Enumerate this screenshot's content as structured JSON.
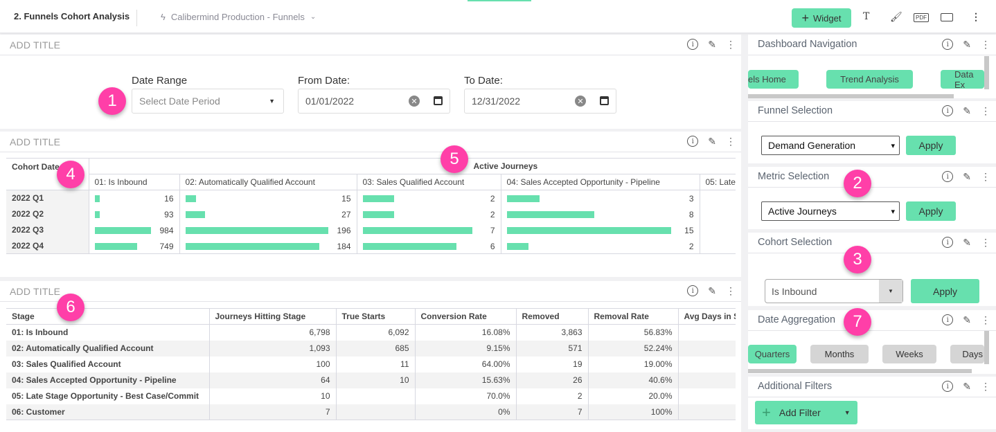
{
  "header": {
    "title": "2. Funnels Cohort Analysis",
    "datasource": "Calibermind Production - Funnels",
    "widget_label": "Widget",
    "icons": [
      "text-icon",
      "brush-icon",
      "pdf-icon",
      "monitor-icon",
      "more-icon"
    ],
    "pdf": "PDF"
  },
  "filters_widget": {
    "title": "ADD TITLE",
    "date_range_label": "Date Range",
    "date_range_placeholder": "Select Date Period",
    "from_label": "From Date:",
    "from_value": "01/01/2022",
    "to_label": "To Date:",
    "to_value": "12/31/2022"
  },
  "pivot_widget": {
    "title": "ADD TITLE",
    "row_header": "Cohort Date",
    "group_header": "Active Journeys",
    "columns": [
      "01: Is Inbound",
      "02: Automatically Qualified Account",
      "03: Sales Qualified Account",
      "04: Sales Accepted Opportunity - Pipeline",
      "05: Late"
    ],
    "rows": [
      {
        "label": "2022 Q1",
        "values": [
          16,
          15,
          2,
          3
        ]
      },
      {
        "label": "2022 Q2",
        "values": [
          93,
          27,
          2,
          8
        ]
      },
      {
        "label": "2022 Q3",
        "values": [
          984,
          196,
          7,
          15
        ]
      },
      {
        "label": "2022 Q4",
        "values": [
          749,
          184,
          6,
          2
        ]
      }
    ]
  },
  "stage_widget": {
    "title": "ADD TITLE",
    "columns": [
      "Stage",
      "Journeys Hitting Stage",
      "True Starts",
      "Conversion Rate",
      "Removed",
      "Removal Rate",
      "Avg Days in S"
    ],
    "rows": [
      [
        "01: Is Inbound",
        "6,798",
        "6,092",
        "16.08%",
        "3,863",
        "56.83%",
        ""
      ],
      [
        "02: Automatically Qualified Account",
        "1,093",
        "685",
        "9.15%",
        "571",
        "52.24%",
        ""
      ],
      [
        "03: Sales Qualified Account",
        "100",
        "11",
        "64.00%",
        "19",
        "19.00%",
        ""
      ],
      [
        "04: Sales Accepted Opportunity - Pipeline",
        "64",
        "10",
        "15.63%",
        "26",
        "40.6%",
        ""
      ],
      [
        "05: Late Stage Opportunity - Best Case/Commit",
        "10",
        "",
        "70.0%",
        "2",
        "20.0%",
        ""
      ],
      [
        "06: Customer",
        "7",
        "",
        "0%",
        "7",
        "100%",
        ""
      ]
    ]
  },
  "sidebar": {
    "nav": {
      "title": "Dashboard Navigation",
      "buttons": [
        "els Home",
        "Trend Analysis",
        "Data Ex"
      ]
    },
    "funnel": {
      "title": "Funnel Selection",
      "value": "Demand Generation",
      "apply": "Apply"
    },
    "metric": {
      "title": "Metric Selection",
      "value": "Active Journeys",
      "apply": "Apply"
    },
    "cohort": {
      "title": "Cohort Selection",
      "value": "Is Inbound",
      "apply": "Apply"
    },
    "date_agg": {
      "title": "Date Aggregation",
      "options": [
        "Quarters",
        "Months",
        "Weeks",
        "Days"
      ],
      "selected": "Quarters"
    },
    "filters": {
      "title": "Additional Filters",
      "add_label": "Add Filter"
    }
  },
  "badges": [
    "1",
    "2",
    "3",
    "4",
    "5",
    "6",
    "7"
  ],
  "colors": {
    "accent": "#67e0ae",
    "badge": "#ff3fa8"
  }
}
